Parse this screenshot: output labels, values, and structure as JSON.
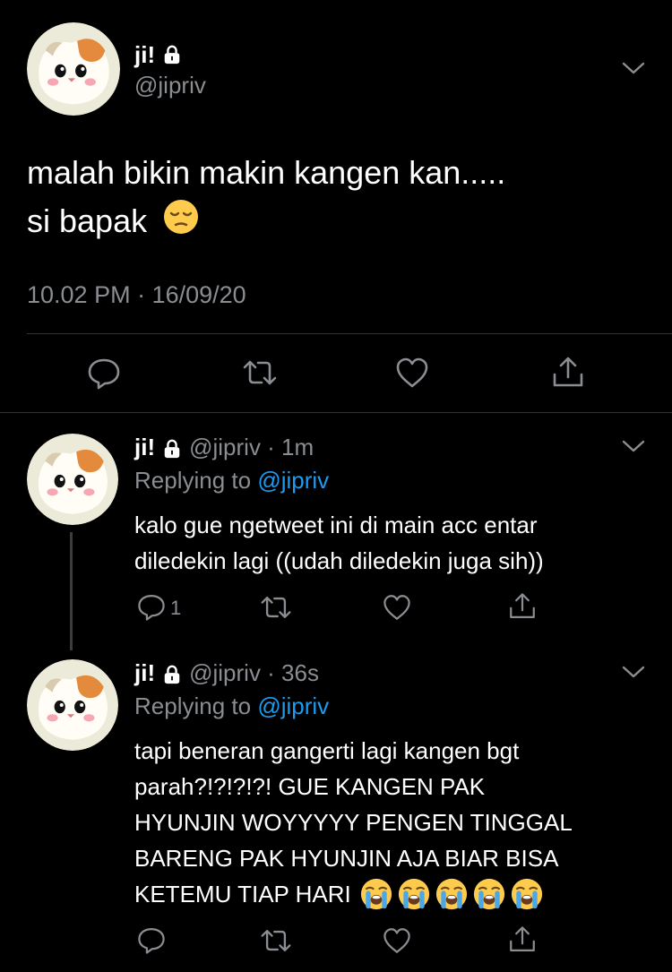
{
  "main_tweet": {
    "display_name": "ji!",
    "handle": "@jipriv",
    "text_line1": "malah bikin makin kangen kan.....",
    "text_line2": "si bapak",
    "timestamp": "10.02 PM · 16/09/20"
  },
  "replies": [
    {
      "display_name": "ji!",
      "handle_time": "@jipriv · 1m",
      "replying_prefix": "Replying to",
      "replying_handle": "@jipriv",
      "lines": [
        "kalo gue ngetweet ini di main acc entar",
        "diledekin lagi ((udah diledekin juga sih))"
      ],
      "reply_count": "1"
    },
    {
      "display_name": "ji!",
      "handle_time": "@jipriv · 36s",
      "replying_prefix": "Replying to",
      "replying_handle": "@jipriv",
      "lines": [
        "tapi beneran gangerti lagi kangen bgt",
        "parah?!?!?!?! GUE KANGEN PAK",
        "HYUNJIN WOYYYYY PENGEN TINGGAL",
        "BARENG PAK HYUNJIN AJA BIAR BISA",
        "KETEMU TIAP HARI"
      ],
      "reply_count": ""
    }
  ],
  "icons": [
    "lock-icon",
    "chevron-down-icon",
    "reply-icon",
    "retweet-icon",
    "like-icon",
    "share-icon",
    "pensive-face-emoji",
    "crying-face-emoji"
  ],
  "colors": {
    "background": "#000000",
    "text": "#ffffff",
    "secondary": "#8a8d91",
    "link": "#1d9bf0",
    "divider": "#2f3336"
  }
}
